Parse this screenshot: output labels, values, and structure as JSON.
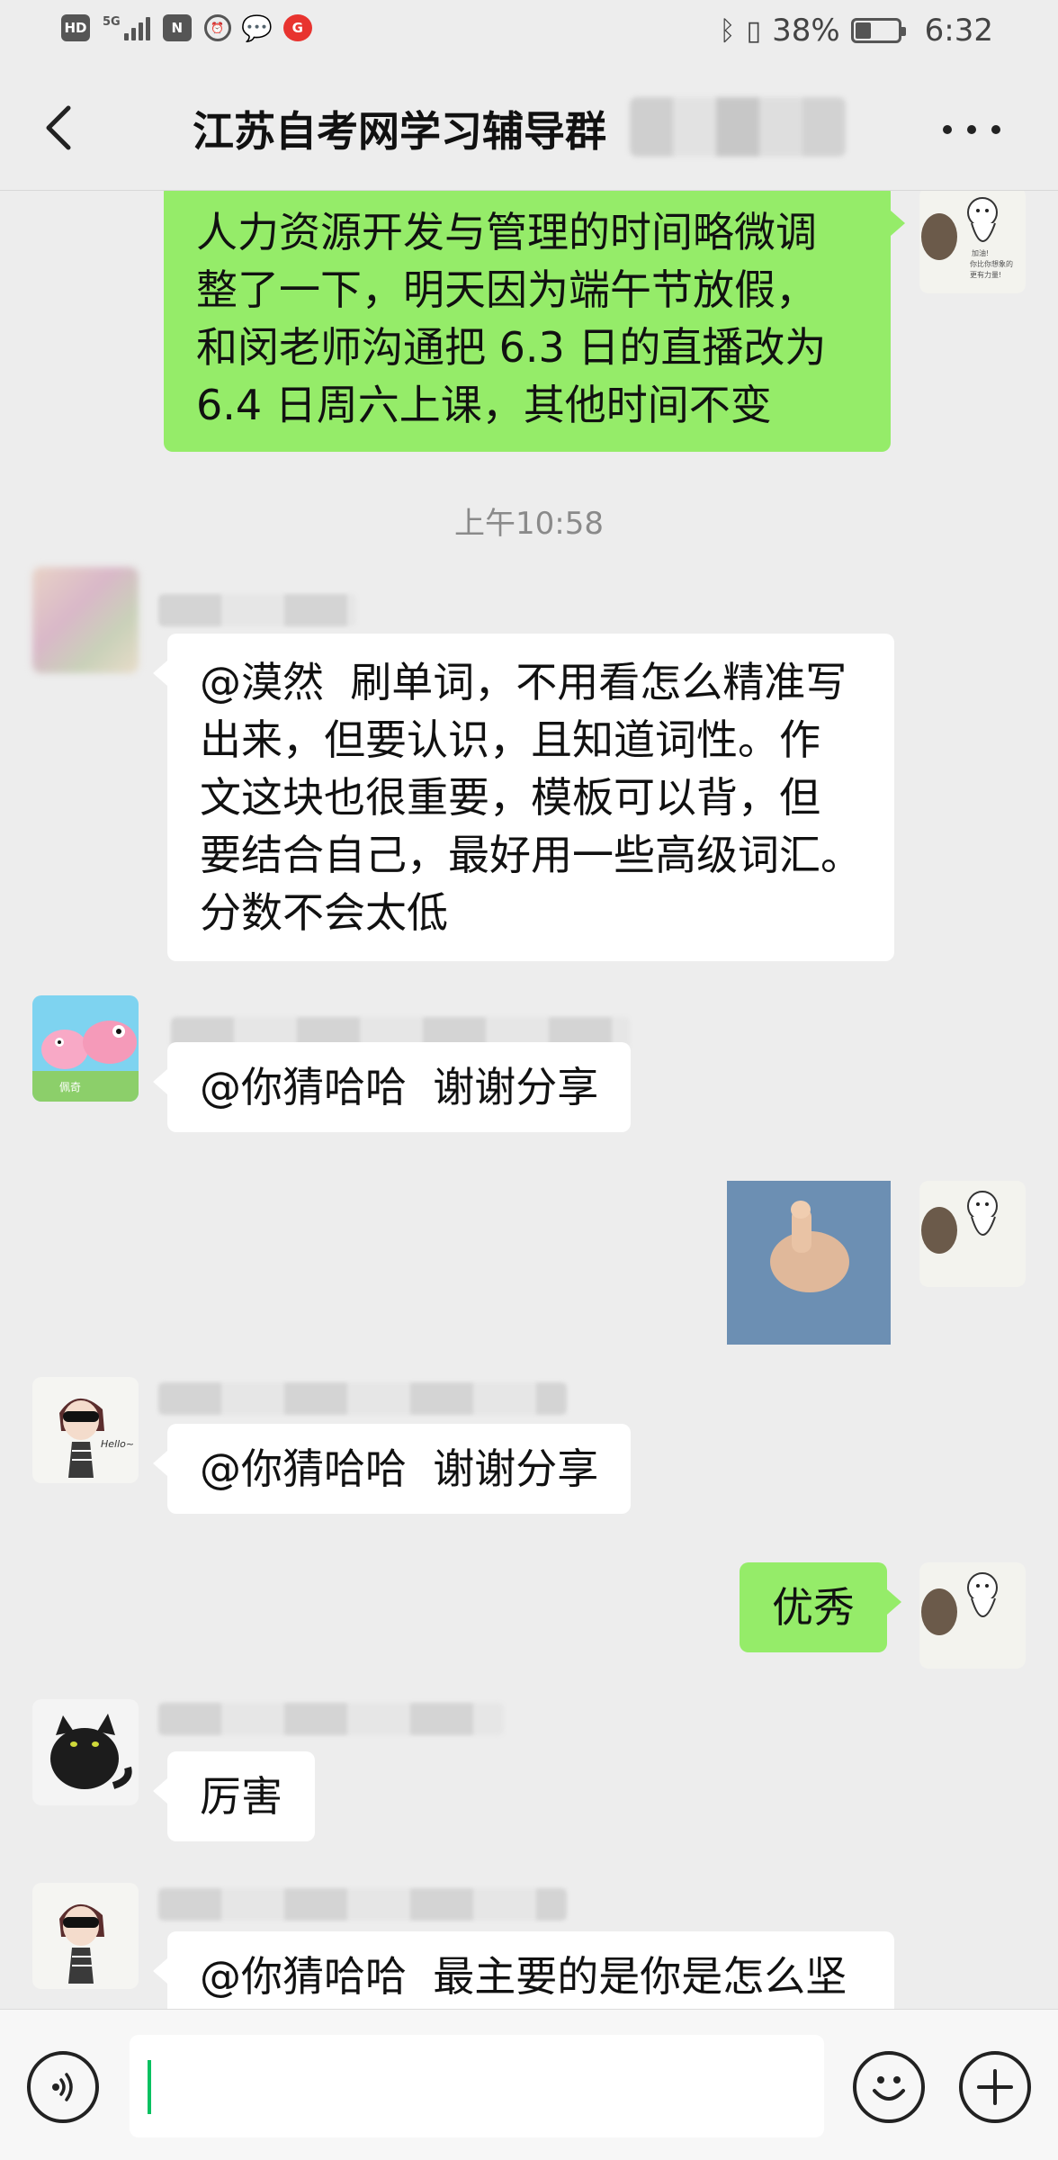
{
  "status_bar": {
    "hd_label": "HD",
    "network_label": "5G",
    "nfc_label": "N",
    "battery_percent": "38%",
    "battery_level": 0.38,
    "time": "6:32"
  },
  "header": {
    "title": "江苏自考网学习辅导群"
  },
  "messages": [
    {
      "side": "out",
      "text": "人力资源开发与管理的时间略微调\n整了一下，明天因为端午节放假，\n和闵老师沟通把 6.3 日的直播改为\n6.4 日周六上课，其他时间不变"
    },
    {
      "type": "timestamp",
      "text": "上午10:58"
    },
    {
      "side": "in",
      "text": "@漠然  刷单词，不用看怎么精准写\n出来，但要认识，且知道词性。作\n文这块也很重要，模板可以背，但\n要结合自己，最好用一些高级词汇。\n分数不会太低"
    },
    {
      "side": "in",
      "text": "@你猜哈哈  谢谢分享"
    },
    {
      "side": "out",
      "type": "image",
      "content": "thumbs-up sticker"
    },
    {
      "side": "in",
      "text": "@你猜哈哈  谢谢分享"
    },
    {
      "side": "out",
      "text": "优秀"
    },
    {
      "side": "in",
      "text": "厉害"
    },
    {
      "side": "in",
      "text": "@你猜哈哈  最主要的是你是怎么坚"
    }
  ],
  "avatars": {
    "self_caption": "加油！\n你比你想象的\n更有力量！",
    "peppa_caption": "佩奇",
    "hello_caption": "Hello~"
  },
  "colors": {
    "background": "#ededed",
    "outgoing_bubble": "#95ec69",
    "incoming_bubble": "#ffffff",
    "cursor": "#07c160"
  },
  "icons": [
    "back-icon",
    "more-icon",
    "voice-icon",
    "emoji-icon",
    "plus-icon"
  ]
}
